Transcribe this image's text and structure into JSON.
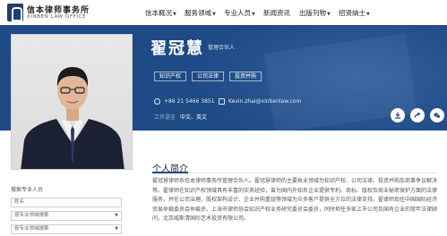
{
  "header": {
    "logo_cn": "信本律师事务所",
    "logo_en": "XINBEN LAW OFFICE",
    "nav": [
      {
        "label": "信本概况",
        "has_dropdown": true
      },
      {
        "label": "服务领域",
        "has_dropdown": true
      },
      {
        "label": "专业人员",
        "has_dropdown": true
      },
      {
        "label": "新闻资讯",
        "has_dropdown": false
      },
      {
        "label": "出版刊物",
        "has_dropdown": true
      },
      {
        "label": "招贤纳士",
        "has_dropdown": true
      }
    ]
  },
  "profile": {
    "name": "翟冠慧",
    "title": "管理合伙人",
    "tags": [
      "知识产权",
      "公司法律",
      "投资并购"
    ],
    "phone": "+86 21 5466 3851",
    "email": "Kevin.zhai@xinbenlaw.com",
    "language_label": "工作语言",
    "languages": "中文、英文"
  },
  "sidebar": {
    "search_label": "搜索专业人员",
    "inputs": [
      {
        "placeholder": "姓名",
        "has_dropdown": false
      },
      {
        "placeholder": "按专业领域搜索",
        "has_dropdown": true
      },
      {
        "placeholder": "按专业领域搜索",
        "has_dropdown": true
      }
    ]
  },
  "content": {
    "section_title": "个人简介",
    "bio": "翟冠慧律师系信本律师事务所管理合伙人。翟冠慧律师的主要执业领域为知识产权、公司法律、投资并购及商事争议解决等。翟律师在知识产权领域具有丰富的实务经验，曾为国内外知名企业提供专利、商标、版权及商业秘密保护方面的法律服务，并在公司治理、股权架构设计、企业并购重组等领域为众多客户提供全方位的法律支持。翟律师现任中国国际经济贸易仲裁委员会仲裁员、上海市律师协会知识产权业务研究委员会委员，同时担任多家上市公司及国有企业的常年法律顾问，北京威斯清国际艺术投资有限公司。"
  },
  "colors": {
    "banner": "#1e4a86",
    "accent": "#1e4a86"
  }
}
